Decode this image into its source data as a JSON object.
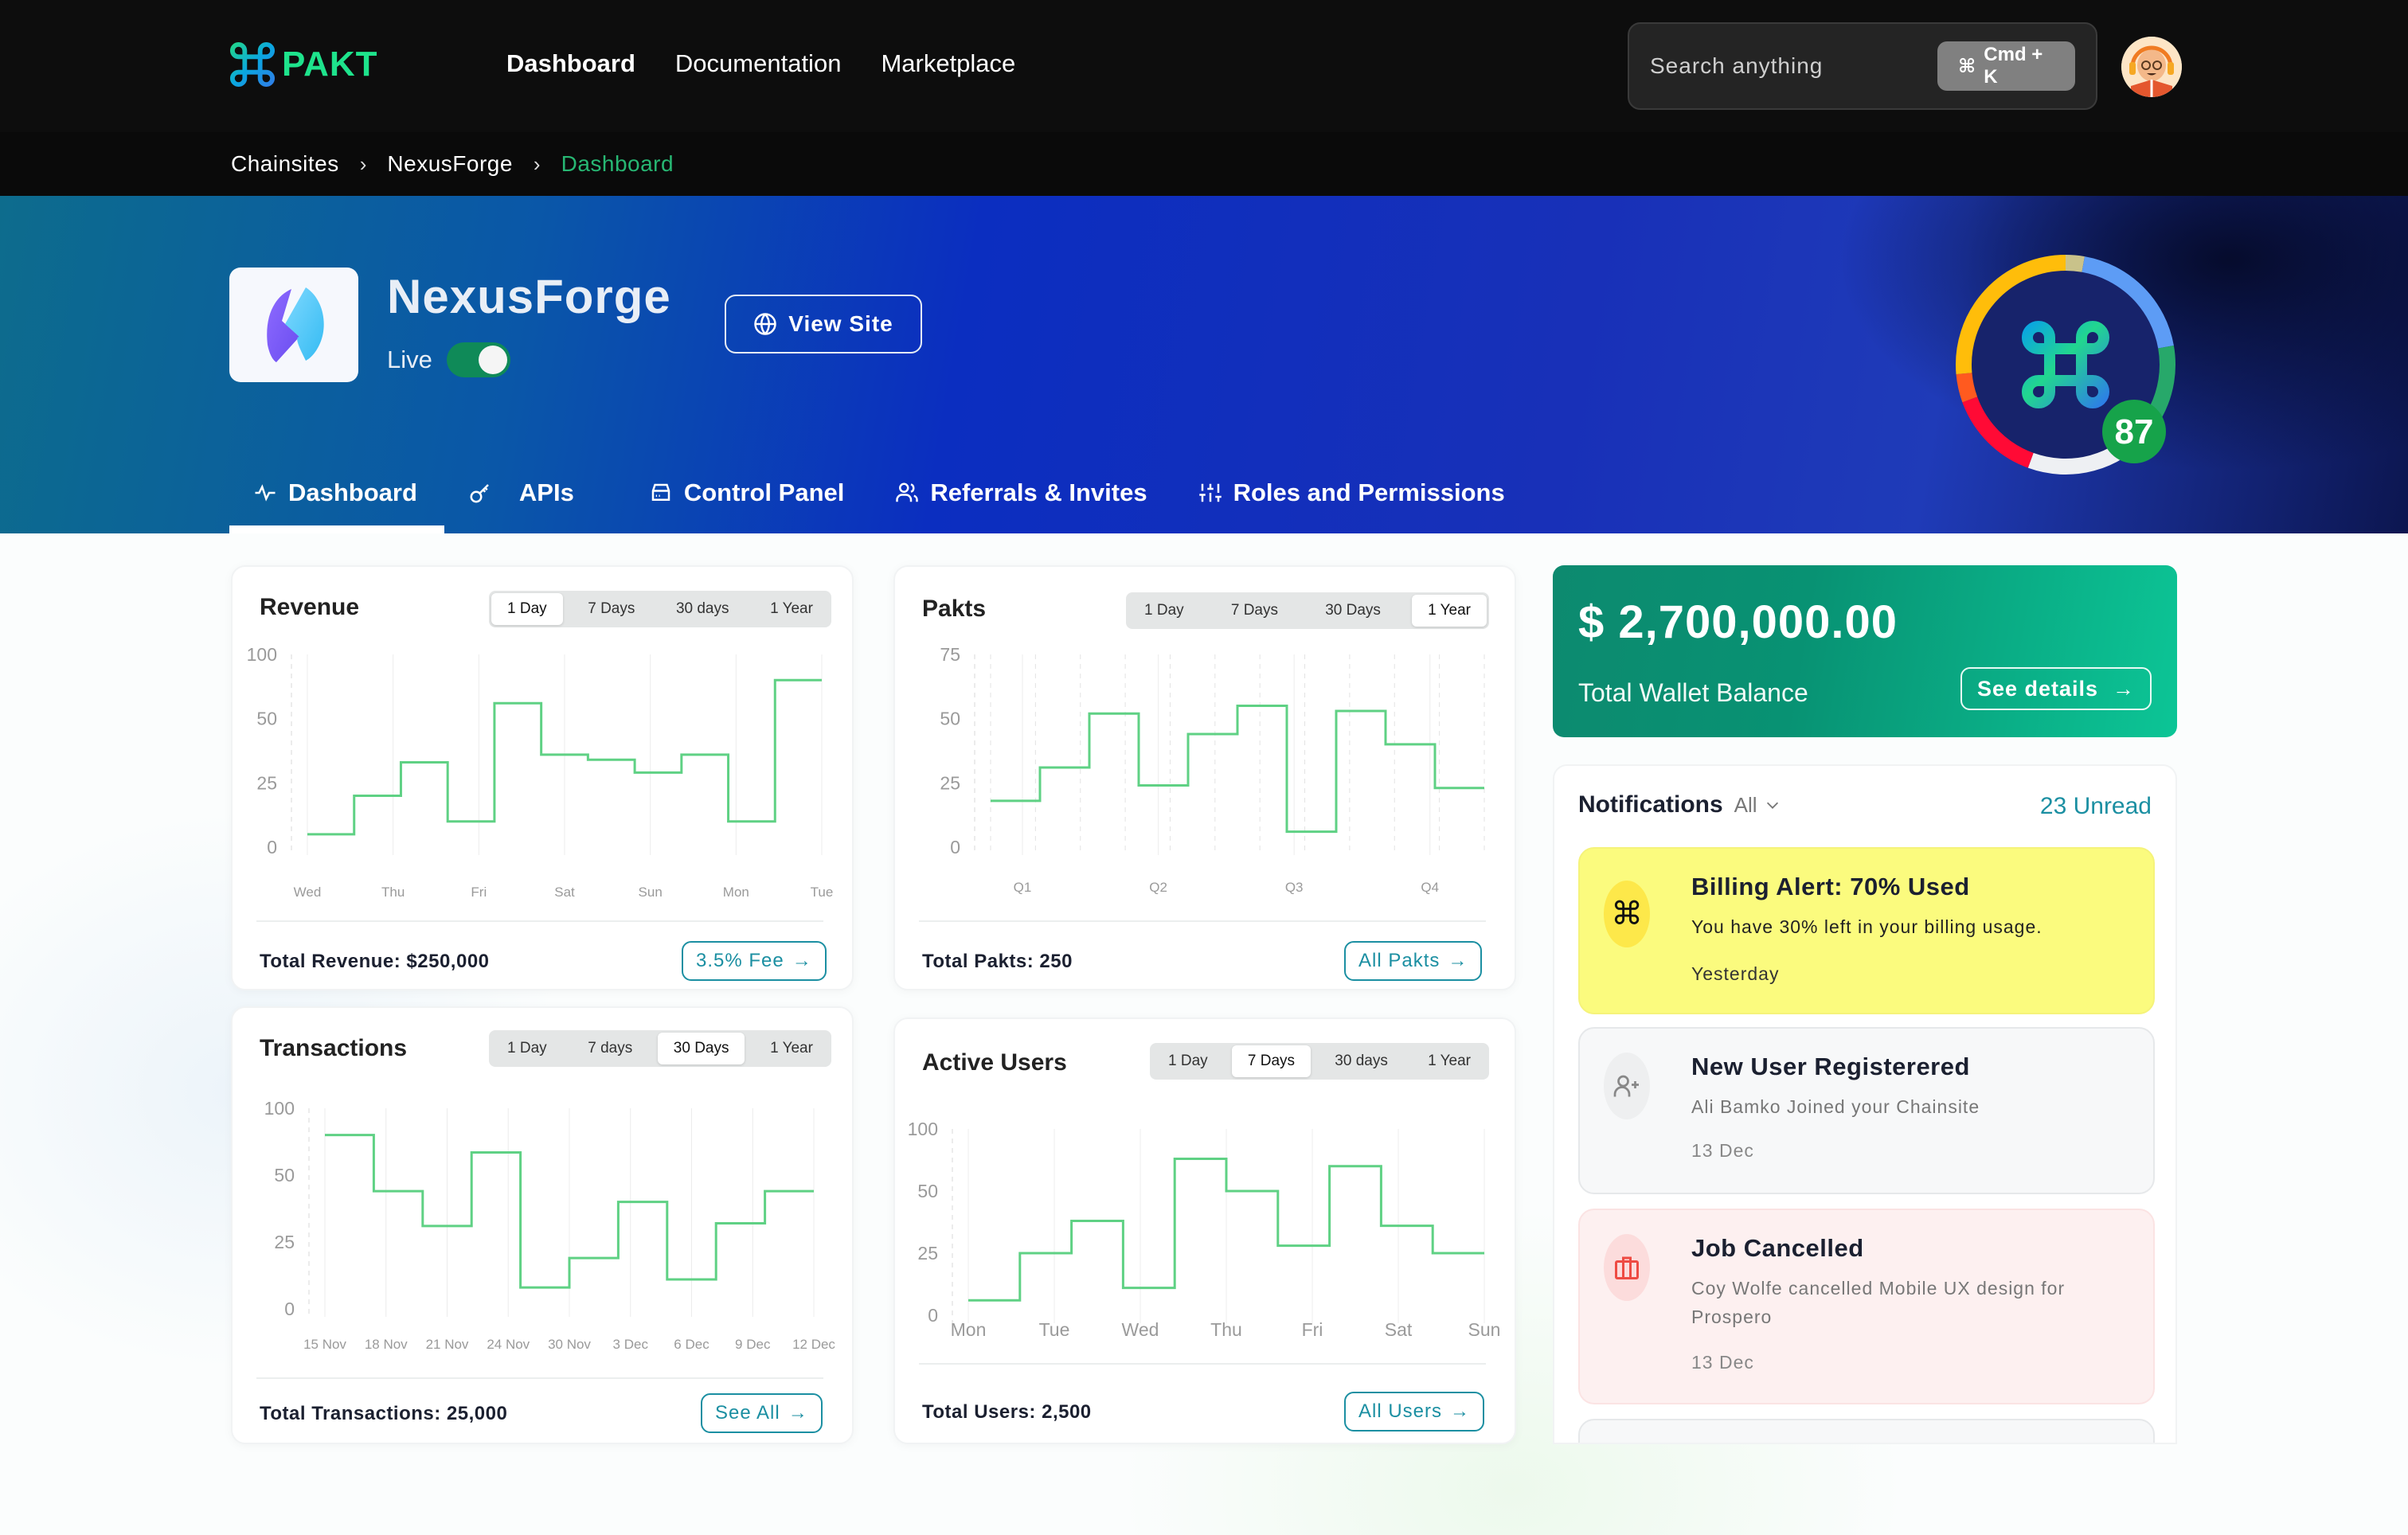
{
  "topbar": {
    "brand": "PAKT",
    "nav": [
      {
        "label": "Dashboard",
        "active": true
      },
      {
        "label": "Documentation",
        "active": false
      },
      {
        "label": "Marketplace",
        "active": false
      }
    ],
    "search_placeholder": "Search anything",
    "shortcut_label": "Cmd + K",
    "shortcut_icon": "command-icon",
    "avatar_icon": "user-avatar"
  },
  "breadcrumb": [
    "Chainsites",
    "NexusForge",
    "Dashboard"
  ],
  "hero": {
    "site_name": "NexusForge",
    "status_label": "Live",
    "live_enabled": true,
    "view_site_label": "View Site",
    "score": "87",
    "score_value": 87,
    "tabs": [
      {
        "label": "Dashboard",
        "icon": "activity-icon",
        "active": true
      },
      {
        "label": "APIs",
        "icon": "key-icon",
        "active": false
      },
      {
        "label": "Control Panel",
        "icon": "hard-drive-icon",
        "active": false
      },
      {
        "label": "Referrals & Invites",
        "icon": "users-icon",
        "active": false
      },
      {
        "label": "Roles and Permissions",
        "icon": "sliders-icon",
        "active": false
      }
    ]
  },
  "wallet": {
    "amount": "$ 2,700,000.00",
    "label": "Total Wallet Balance",
    "button": "See details"
  },
  "notifications": {
    "title": "Notifications",
    "filter": "All",
    "unread": "23 Unread",
    "items": [
      {
        "title": "Billing Alert: 70% Used",
        "body": "You have 30% left in your billing usage.",
        "time": "Yesterday",
        "icon": "command-icon",
        "tone": "warning"
      },
      {
        "title": "New User Registerered",
        "body": "Ali Bamko Joined your Chainsite",
        "time": "13 Dec",
        "icon": "user-plus-icon",
        "tone": "neutral"
      },
      {
        "title": "Job Cancelled",
        "body": "Coy Wolfe cancelled Mobile UX design for Prospero",
        "time": "13 Dec",
        "icon": "briefcase-icon",
        "tone": "danger"
      }
    ]
  },
  "chart_data": [
    {
      "id": "revenue",
      "type": "line",
      "step": true,
      "title": "Revenue",
      "periods": [
        "1 Day",
        "7 Days",
        "30 days",
        "1 Year"
      ],
      "active_period": "1 Day",
      "yticks": [
        0,
        25,
        50,
        100
      ],
      "y_scale": "piecewise (ticks evenly spaced)",
      "ylim": [
        0,
        100
      ],
      "categories": [
        "Wed",
        "Thu",
        "Fri",
        "Sat",
        "Sun",
        "Mon",
        "Tue"
      ],
      "values": [
        5,
        20,
        33,
        10,
        62,
        36,
        34,
        29,
        36,
        10,
        80
      ],
      "grid": "vertical",
      "total_label": "Total Revenue: $250,000",
      "button": "3.5% Fee"
    },
    {
      "id": "pakts",
      "type": "line",
      "step": true,
      "title": "Pakts",
      "periods": [
        "1 Day",
        "7 Days",
        "30 Days",
        "1 Year"
      ],
      "active_period": "1 Year",
      "yticks": [
        0,
        25,
        50,
        75
      ],
      "ylim": [
        0,
        75
      ],
      "categories": [
        "Q1",
        "Q2",
        "Q3",
        "Q4"
      ],
      "values": [
        18,
        31,
        52,
        24,
        44,
        55,
        6,
        53,
        40,
        23
      ],
      "grid": "vertical",
      "total_label": "Total Pakts: 250",
      "button": "All Pakts"
    },
    {
      "id": "transactions",
      "type": "line",
      "step": true,
      "title": "Transactions",
      "periods": [
        "1 Day",
        "7 days",
        "30 Days",
        "1 Year"
      ],
      "active_period": "30 Days",
      "yticks": [
        0,
        25,
        50,
        100
      ],
      "y_scale": "piecewise (ticks evenly spaced)",
      "ylim": [
        0,
        100
      ],
      "categories": [
        "15 Nov",
        "18 Nov",
        "21 Nov",
        "24 Nov",
        "30 Nov",
        "3 Dec",
        "6 Dec",
        "9 Dec",
        "12 Dec"
      ],
      "values": [
        80,
        44,
        31,
        67,
        8,
        19,
        40,
        11,
        32,
        44
      ],
      "grid": "vertical",
      "total_label": "Total Transactions: 25,000",
      "button": "See All"
    },
    {
      "id": "active-users",
      "type": "line",
      "step": true,
      "title": "Active Users",
      "periods": [
        "1 Day",
        "7 Days",
        "30 days",
        "1 Year"
      ],
      "active_period": "7 Days",
      "yticks": [
        0,
        25,
        50,
        100
      ],
      "y_scale": "piecewise (ticks evenly spaced)",
      "ylim": [
        0,
        100
      ],
      "categories": [
        "Mon",
        "Tue",
        "Wed",
        "Thu",
        "Fri",
        "Sat",
        "Sun"
      ],
      "values": [
        6,
        25,
        38,
        11,
        76,
        50,
        28,
        70,
        36,
        25
      ],
      "grid": "vertical",
      "total_label": "Total Users: 2,500",
      "button": "All Users"
    }
  ]
}
